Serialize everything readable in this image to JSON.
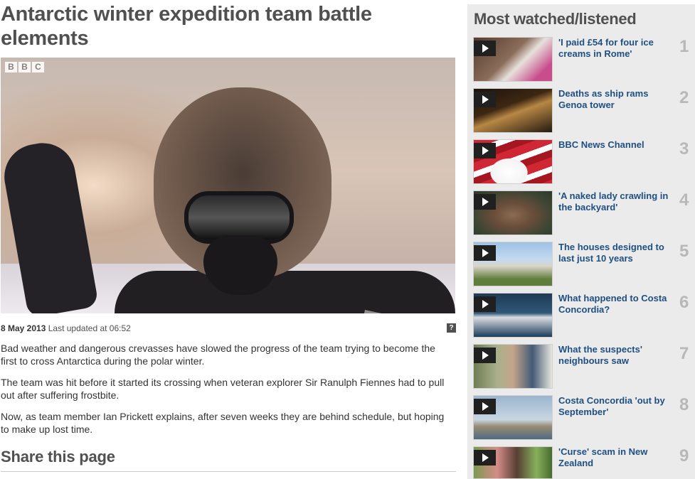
{
  "article": {
    "headline": "Antarctic winter expedition team battle elements",
    "video_logo": [
      "B",
      "B",
      "C"
    ],
    "date": "8 May 2013",
    "updated": "Last updated at 06:52",
    "help_label": "?",
    "paragraphs": [
      "Bad weather and dangerous crevasses have slowed the progress of the team trying to become the first to cross Antarctica during the polar winter.",
      "The team was hit before it started its crossing when veteran explorer Sir Ranulph Fiennes had to pull out after suffering frostbite.",
      "Now, as team member Ian Prickett explains, after seven weeks they are behind schedule, but hoping to make up lost time."
    ],
    "share_heading": "Share this page"
  },
  "sidebar": {
    "heading": "Most watched/listened",
    "items": [
      {
        "title": "'I paid £54 for four ice creams in Rome'",
        "rank": "1"
      },
      {
        "title": "Deaths as ship rams Genoa tower",
        "rank": "2"
      },
      {
        "title": "BBC News Channel",
        "rank": "3"
      },
      {
        "title": "'A naked lady crawling in the backyard'",
        "rank": "4"
      },
      {
        "title": "The houses designed to last just 10 years",
        "rank": "5"
      },
      {
        "title": "What happened to Costa Concordia?",
        "rank": "6"
      },
      {
        "title": "What the suspects' neighbours saw",
        "rank": "7"
      },
      {
        "title": "Costa Concordia 'out by September'",
        "rank": "8"
      },
      {
        "title": "'Curse' scam in New Zealand",
        "rank": "9"
      }
    ]
  },
  "icons": {
    "play": "play-icon",
    "help": "help-icon"
  },
  "colors": {
    "link": "#1f4f82",
    "heading": "#505050",
    "sidebar_bg": "#ebebeb",
    "rank": "#b8b8b8"
  }
}
